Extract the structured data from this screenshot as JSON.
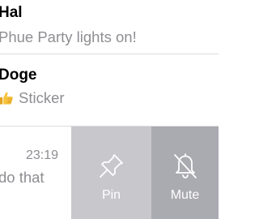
{
  "chats": [
    {
      "name": "Hal",
      "preview": "Phue Party lights on!"
    },
    {
      "name": "Doge",
      "preview": "Sticker",
      "preview_icon": "thumbs-up-emoji"
    },
    {
      "time": "23:19",
      "preview": "do that"
    }
  ],
  "swipe_actions": {
    "pin": {
      "label": "Pin",
      "icon": "pin-icon",
      "color": "#c7c7cc"
    },
    "mute": {
      "label": "Mute",
      "icon": "bell-slash-icon",
      "color": "#aaaab1"
    }
  }
}
